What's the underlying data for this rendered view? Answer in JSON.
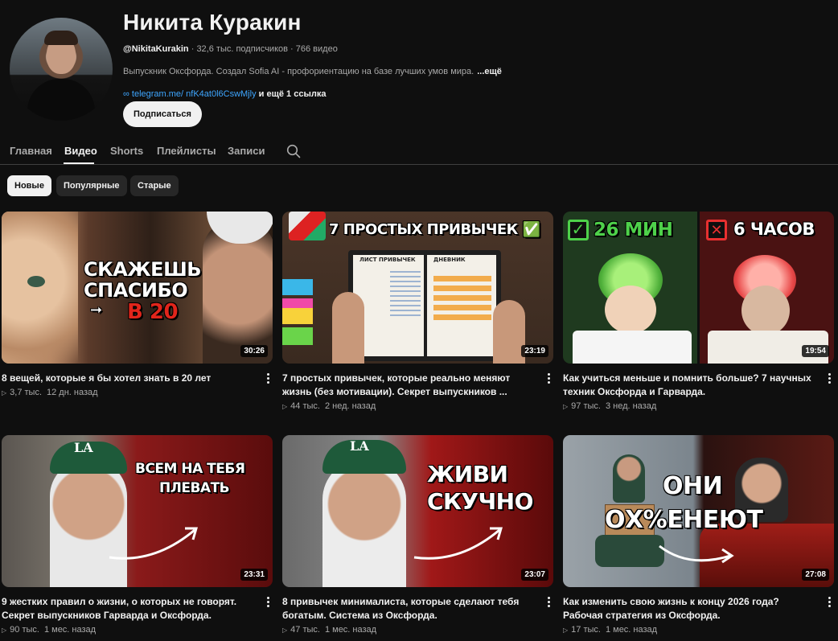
{
  "channel": {
    "name": "Никита Куракин",
    "handle": "@NikitaKurakin",
    "subscribers": "32,6 тыс. подписчиков",
    "videos_count": "766 видео",
    "description": "Выпускник Оксфорда. Создал Sofia AI - профориентацию на базе лучших умов мира.",
    "description_more": "...ещё",
    "link_text": "telegram.me/ nfK4at0l6CswMjly",
    "link_more": "и ещё 1 ссылка",
    "subscribe_label": "Подписаться"
  },
  "tabs": [
    {
      "label": "Главная"
    },
    {
      "label": "Видео"
    },
    {
      "label": "Shorts"
    },
    {
      "label": "Плейлисты"
    },
    {
      "label": "Записи"
    }
  ],
  "chips": [
    {
      "label": "Новые"
    },
    {
      "label": "Популярные"
    },
    {
      "label": "Старые"
    }
  ],
  "videos": [
    {
      "title": "8 вещей, которые я бы хотел знать в 20 лет",
      "views": "3,7 тыс.",
      "ago": "12 дн. назад",
      "duration": "30:26",
      "thumb_text_1": "СКАЖЕШЬ",
      "thumb_text_2": "СПАСИБО",
      "thumb_text_3": "В 20"
    },
    {
      "title": "7 простых привычек, которые реально меняют жизнь (без мотивации). Секрет выпускников ...",
      "views": "44 тыс.",
      "ago": "2 нед. назад",
      "duration": "23:19",
      "thumb_text_1": "7 ПРОСТЫХ ПРИВЫЧЕК ✅",
      "thumb_text_2": "ЛИСТ ПРИВЫЧЕК",
      "thumb_text_3": "ДНЕВНИК"
    },
    {
      "title": "Как учиться меньше и помнить больше? 7 научных техник Оксфорда и Гарварда.",
      "views": "97 тыс.",
      "ago": "3 нед. назад",
      "duration": "19:54",
      "thumb_text_1": "26 МИН",
      "thumb_text_2": "6 ЧАСОВ"
    },
    {
      "title": "9 жестких правил о жизни, о которых не говорят. Секрет выпускников Гарварда и Оксфорда.",
      "views": "90 тыс.",
      "ago": "1 мес. назад",
      "duration": "23:31",
      "thumb_text_1": "ВСЕМ НА ТЕБЯ",
      "thumb_text_2": "ПЛЕВАТЬ"
    },
    {
      "title": "8 привычек минималиста, которые сделают тебя богатым. Система из Оксфорда.",
      "views": "47 тыс.",
      "ago": "1 мес. назад",
      "duration": "23:07",
      "thumb_text_1": "ЖИВИ",
      "thumb_text_2": "СКУЧНО"
    },
    {
      "title": "Как изменить свою жизнь к концу 2026 года? Рабочая стратегия из Оксфорда.",
      "views": "17 тыс.",
      "ago": "1 мес. назад",
      "duration": "27:08",
      "thumb_text_1": "ОНИ",
      "thumb_text_2": "ОХ%ЕНЕЮТ"
    }
  ],
  "icons": {
    "search": "search-icon",
    "link": "link-icon",
    "play": "play-icon",
    "more": "more-vert-icon"
  },
  "colors": {
    "background": "#0f0f0f",
    "link": "#3ea6ff",
    "chip": "#272727",
    "active_chip": "#f1f1f1"
  }
}
